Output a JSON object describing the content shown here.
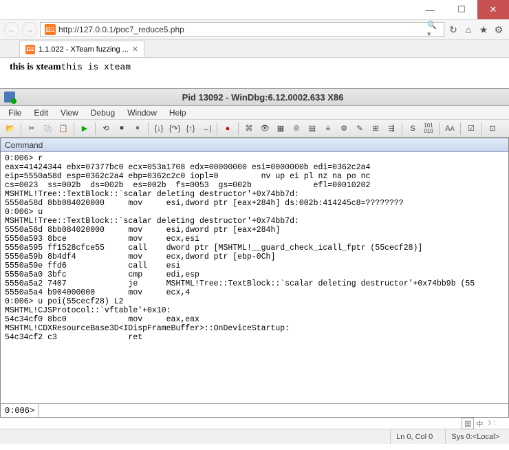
{
  "browser": {
    "url": "http://127.0.0.1/poc7_reduce5.php",
    "tab_title": "1.1.022 - XTeam fuzzing ...",
    "page_bold": "this is xteam",
    "page_mono": "this is xteam"
  },
  "windbg": {
    "title": "Pid 13092 - WinDbg:6.12.0002.633 X86",
    "menu": [
      "File",
      "Edit",
      "View",
      "Debug",
      "Window",
      "Help"
    ],
    "command_label": "Command",
    "prompt": "0:006>",
    "output": "0:006> r\neax=41424344 ebx=07377bc0 ecx=053a1708 edx=00000000 esi=0000000b edi=0362c2a4\neip=5550a58d esp=0362c2a4 ebp=0362c2c0 iopl=0         nv up ei pl nz na po nc\ncs=0023  ss=002b  ds=002b  es=002b  fs=0053  gs=002b             efl=00010202\nMSHTML!Tree::TextBlock::`scalar deleting destructor'+0x74bb7d:\n5550a58d 8bb084020000     mov     esi,dword ptr [eax+284h] ds:002b:414245c8=????????\n0:006> u\nMSHTML!Tree::TextBlock::`scalar deleting destructor'+0x74bb7d:\n5550a58d 8bb084020000     mov     esi,dword ptr [eax+284h]\n5550a593 8bce             mov     ecx,esi\n5550a595 ff1528cfce55     call    dword ptr [MSHTML!__guard_check_icall_fptr (55cecf28)]\n5550a59b 8b4df4           mov     ecx,dword ptr [ebp-0Ch]\n5550a59e ffd6             call    esi\n5550a5a0 3bfc             cmp     edi,esp\n5550a5a2 7407             je      MSHTML!Tree::TextBlock::`scalar deleting destructor'+0x74bb9b (55\n5550a5a4 b904000000       mov     ecx,4\n0:006> u poi(55cecf28) L2\nMSHTML!CJSProtocol::`vftable'+0x10:\n54c34cf0 8bc0             mov     eax,eax\nMSHTML!CDXResourceBase3D<IDispFrameBuffer>::OnDeviceStartup:\n54c34cf2 c3               ret"
  },
  "status": {
    "pos": "Ln 0, Col 0",
    "sys": "Sys 0:<Local>",
    "ime": [
      "国",
      "中",
      "☽",
      ":"
    ]
  }
}
